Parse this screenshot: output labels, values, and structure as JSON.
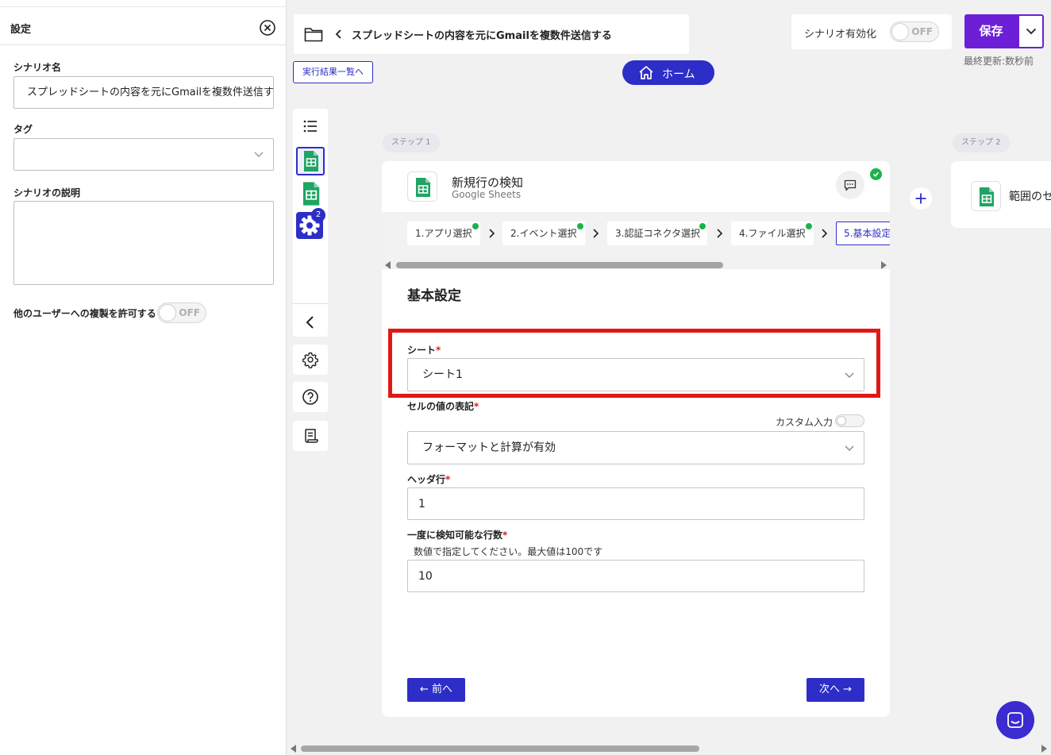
{
  "left_panel": {
    "title": "設定",
    "scenario_name_label": "シナリオ名",
    "scenario_name_value": "スプレッドシートの内容を元にGmailを複数件送信する",
    "tag_label": "タグ",
    "tag_value": "",
    "description_label": "シナリオの説明",
    "description_value": "",
    "allow_copy_label": "他のユーザーへの複製を許可する",
    "allow_copy_toggle": "OFF"
  },
  "header": {
    "scenario_title": "スプレッドシートの内容を元にGmailを複数件送信する",
    "results_link": "実行結果一覧へ",
    "home_label": "ホーム",
    "enable_label": "シナリオ有効化",
    "enable_toggle": "OFF",
    "save_label": "保存",
    "last_updated": "最終更新:数秒前"
  },
  "toolbar": {
    "settings_badge": "2"
  },
  "steps": {
    "step1_label": "ステップ 1",
    "step2_label": "ステップ 2"
  },
  "card": {
    "title": "新規行の検知",
    "subtitle": "Google Sheets",
    "tabs": [
      {
        "label": "1.アプリ選択"
      },
      {
        "label": "2.イベント選択"
      },
      {
        "label": "3.認証コネクタ選択"
      },
      {
        "label": "4.ファイル選択"
      },
      {
        "label": "5.基本設定"
      }
    ],
    "section_title": "基本設定",
    "fields": {
      "sheet_label": "シート",
      "sheet_value": "シート1",
      "cell_format_label": "セルの値の表記",
      "custom_input_label": "カスタム入力",
      "cell_format_value": "フォーマットと計算が有効",
      "header_row_label": "ヘッダ行",
      "header_row_value": "1",
      "max_rows_label": "一度に検知可能な行数",
      "max_rows_help": "数値で指定してください。最大値は100です",
      "max_rows_value": "10",
      "required_mark": "*"
    },
    "prev_label": "← 前へ",
    "next_label": "次へ →"
  },
  "card2": {
    "title": "範囲のセ"
  },
  "colors": {
    "accent": "#2d2dc8",
    "save": "#6c1fd6",
    "highlight": "#e01818",
    "success": "#1ab34b",
    "sheets_green": "#1fa463"
  }
}
